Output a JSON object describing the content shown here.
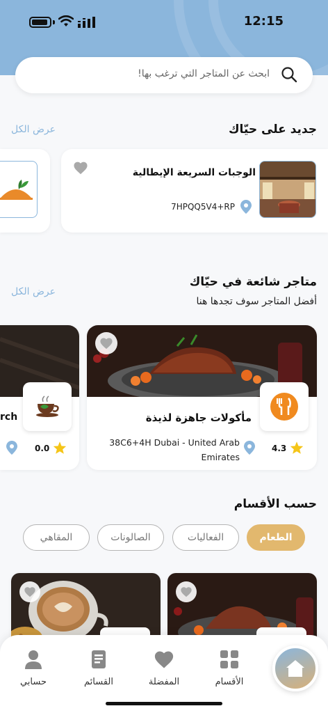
{
  "status_bar": {
    "time": "12:15"
  },
  "search": {
    "placeholder": "ابحث عن المتاجر التي ترغب بها!"
  },
  "new_section": {
    "title": "جديد على حيّاك",
    "see_all": "عرض الكل",
    "items": [
      {
        "name": "الوجبات السريعة الإيطالية",
        "location": "7HPQQ5V4+RP"
      }
    ]
  },
  "popular_section": {
    "title": "متاجر شائعة في حيّاك",
    "subtitle": "أفضل المتاجر سوف تجدها هنا",
    "see_all": "عرض الكل",
    "items": [
      {
        "name": "مأكولات جاهزة لذيذة",
        "rating": "4.3",
        "location": "38C6+4H Dubai - United Arab Emirates"
      },
      {
        "name": "rch",
        "rating": "0.0"
      }
    ]
  },
  "categories_section": {
    "title": "حسب الأقسام",
    "pills": [
      "الطعام",
      "الفعاليات",
      "الصالونات",
      "المقاهي"
    ],
    "active_index": 0
  },
  "bottom_nav": {
    "items": [
      "الأقسام",
      "المفضلة",
      "القسائم",
      "حسابي"
    ]
  },
  "colors": {
    "accent": "#8bb6dc",
    "highlight": "#e2b86e",
    "star": "#f5c518"
  }
}
